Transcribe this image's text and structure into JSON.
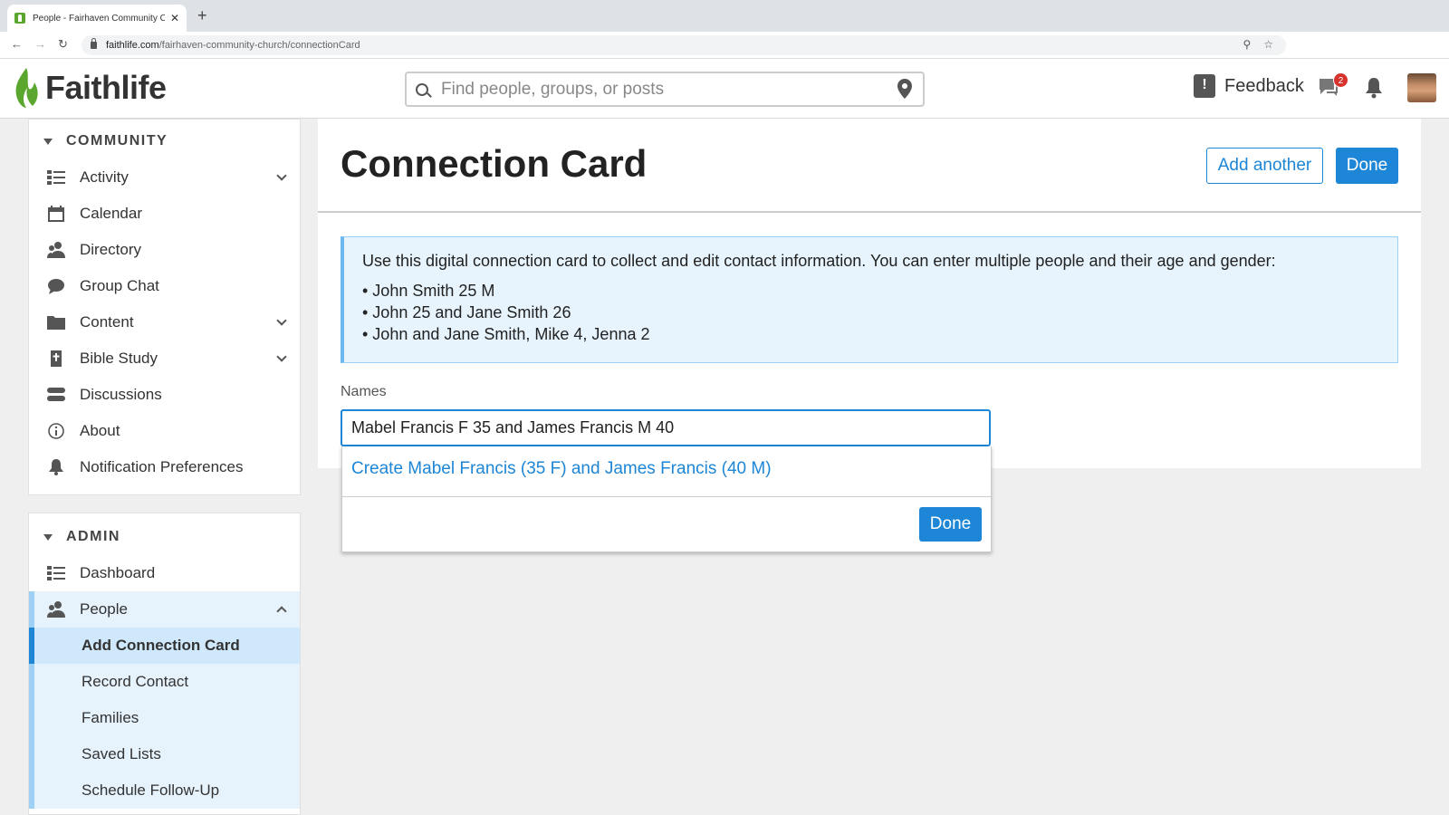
{
  "browser": {
    "tab_title": "People - Fairhaven Community C",
    "new_tab": "+",
    "close": "✕",
    "url_host": "faithlife.com",
    "url_path": "/fairhaven-community-church/connectionCard"
  },
  "header": {
    "logo_text": "Faithlife",
    "search_placeholder": "Find people, groups, or posts",
    "feedback_label": "Feedback",
    "chat_badge": "2"
  },
  "sidebar": {
    "community": {
      "title": "COMMUNITY",
      "items": [
        {
          "label": "Activity",
          "icon": "activity-icon",
          "expandable": true
        },
        {
          "label": "Calendar",
          "icon": "calendar-icon"
        },
        {
          "label": "Directory",
          "icon": "directory-icon"
        },
        {
          "label": "Group Chat",
          "icon": "chat-bubble-icon"
        },
        {
          "label": "Content",
          "icon": "folder-icon",
          "expandable": true
        },
        {
          "label": "Bible Study",
          "icon": "bible-icon",
          "expandable": true
        },
        {
          "label": "Discussions",
          "icon": "discussions-icon"
        },
        {
          "label": "About",
          "icon": "info-icon"
        },
        {
          "label": "Notification Preferences",
          "icon": "bell-icon"
        }
      ]
    },
    "admin": {
      "title": "ADMIN",
      "items": [
        {
          "label": "Dashboard",
          "icon": "dashboard-icon"
        },
        {
          "label": "People",
          "icon": "people-icon",
          "expanded": true
        }
      ],
      "sub_items": [
        {
          "label": "Add Connection Card",
          "active": true
        },
        {
          "label": "Record Contact"
        },
        {
          "label": "Families"
        },
        {
          "label": "Saved Lists"
        },
        {
          "label": "Schedule Follow-Up"
        }
      ]
    }
  },
  "main": {
    "title": "Connection Card",
    "add_another": "Add another",
    "done": "Done",
    "info_text": "Use this digital connection card to collect and edit contact information. You can enter multiple people and their age and gender:",
    "info_examples": [
      "• John Smith 25 M",
      "• John 25 and Jane Smith 26",
      "• John and Jane Smith, Mike 4, Jenna 2"
    ],
    "names_label": "Names",
    "names_value": "Mabel Francis F 35 and James Francis M 40",
    "suggestion": "Create Mabel Francis (35 F) and James Francis (40 M)",
    "dropdown_done": "Done"
  },
  "colors": {
    "accent": "#1e86d6",
    "info_bg": "#e7f4fd",
    "brand_green": "#5aa62e"
  }
}
